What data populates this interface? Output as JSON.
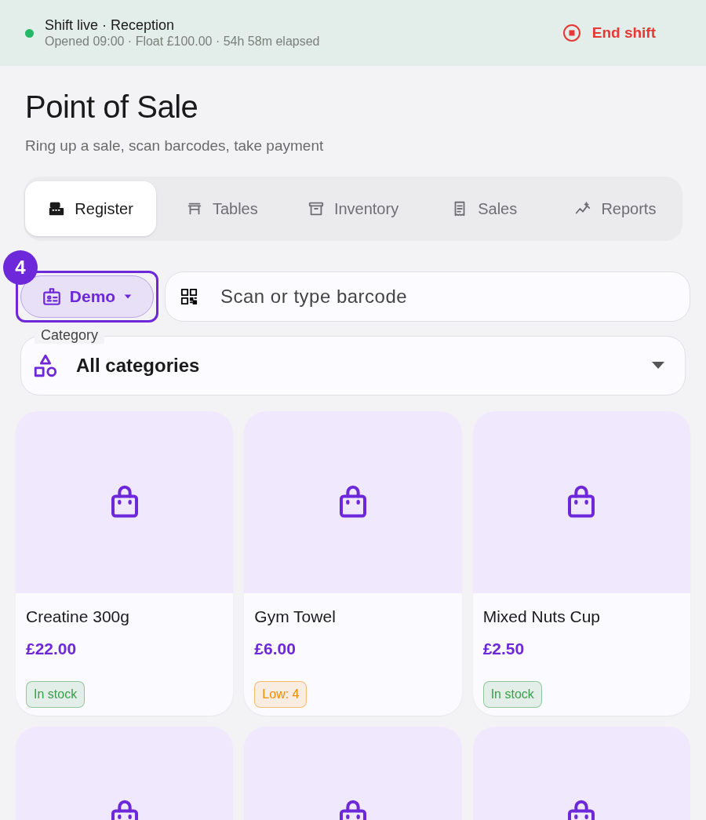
{
  "shift_bar": {
    "title": "Shift live · Reception",
    "details": "Opened 09:00 · Float £100.00 · 54h 58m elapsed",
    "end_button": "End shift"
  },
  "header": {
    "title": "Point of Sale",
    "subtitle": "Ring up a sale, scan barcodes, take payment"
  },
  "tabs": [
    {
      "label": "Register",
      "selected": true
    },
    {
      "label": "Tables",
      "selected": false
    },
    {
      "label": "Inventory",
      "selected": false
    },
    {
      "label": "Sales",
      "selected": false
    },
    {
      "label": "Reports",
      "selected": false
    }
  ],
  "customer_button": {
    "label": "Demo",
    "badge": "4"
  },
  "barcode_field": {
    "placeholder": "Scan or type barcode"
  },
  "category_select": {
    "label": "Category",
    "value": "All categories"
  },
  "products": [
    {
      "kind": "full",
      "name": "Creatine 300g",
      "price": "£22.00",
      "stock": "In stock",
      "color": "#3aa04a"
    },
    {
      "kind": "full",
      "name": "Gym Towel",
      "price": "£6.00",
      "stock": "Low: 4",
      "color": "#f08c00"
    },
    {
      "kind": "full",
      "name": "Mixed Nuts Cup",
      "price": "£2.50",
      "stock": "In stock",
      "color": "#3aa04a"
    },
    {
      "kind": "partial"
    },
    {
      "kind": "partial"
    },
    {
      "kind": "partial"
    }
  ]
}
